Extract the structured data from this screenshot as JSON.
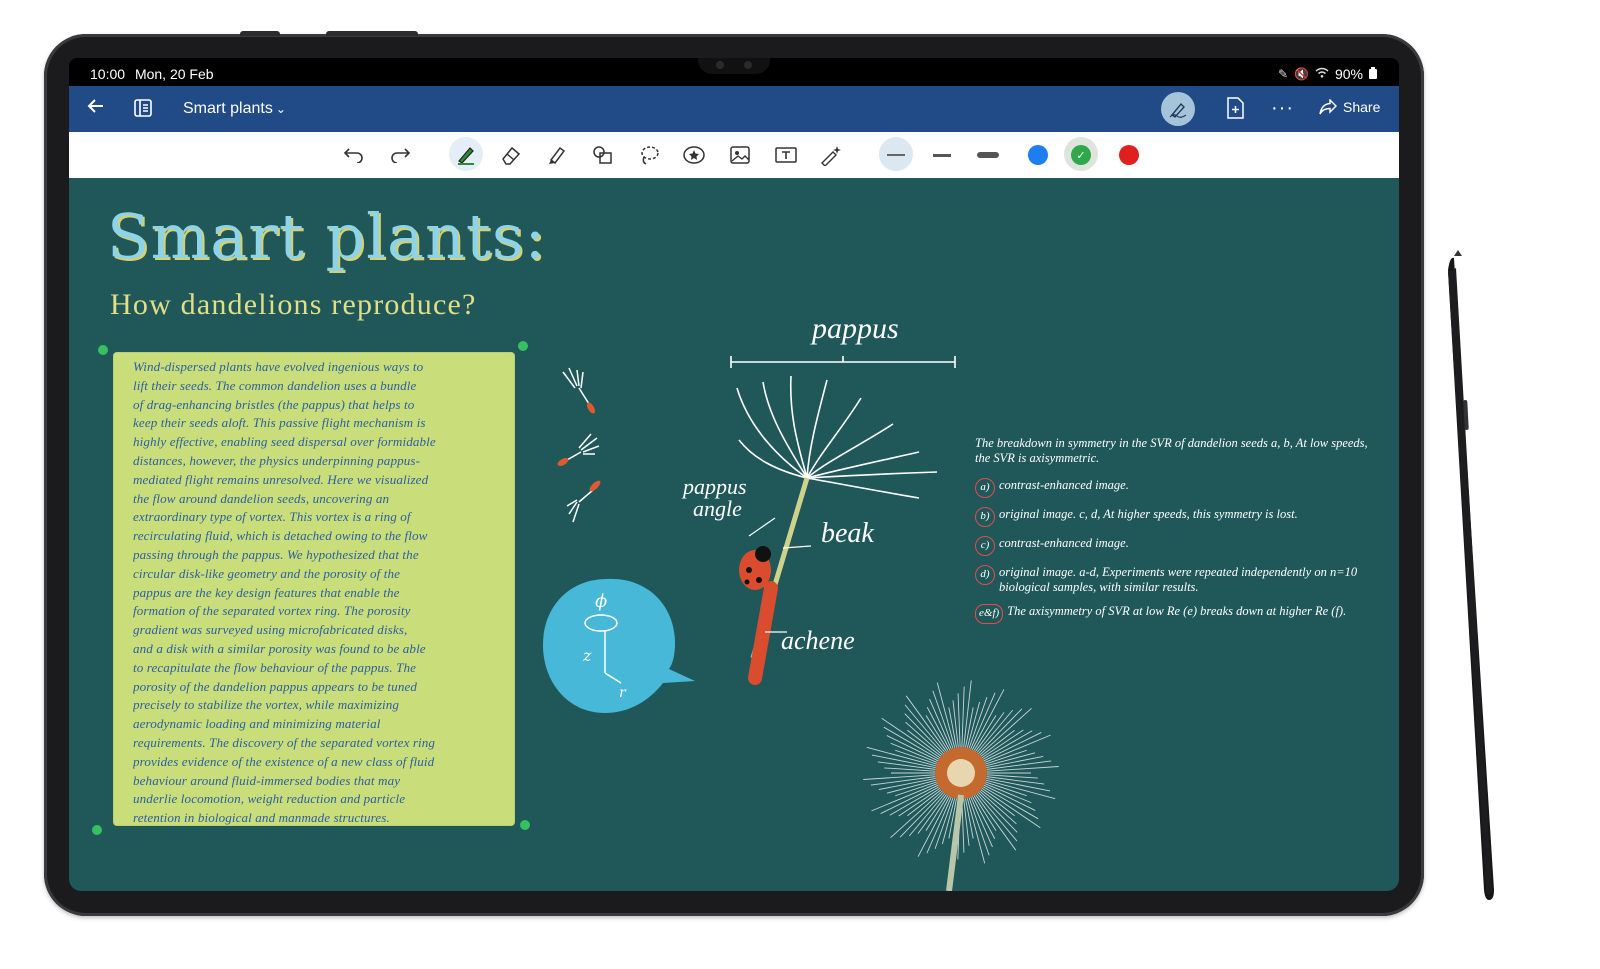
{
  "status_bar": {
    "time": "10:00",
    "date": "Mon, 20 Feb",
    "battery": "90%"
  },
  "app_bar": {
    "title": "Smart plants",
    "share_label": "Share"
  },
  "toolbar": {
    "tools": [
      "undo-icon",
      "redo-icon",
      "pen-icon",
      "eraser-icon",
      "highlighter-icon",
      "shapes-icon",
      "lasso-icon",
      "sticker-icon",
      "image-icon",
      "text-box-icon",
      "magic-icon"
    ],
    "active_tool": "pen-icon",
    "thickness_options": [
      "thin",
      "medium",
      "thick"
    ],
    "selected_thickness": "thin",
    "colors": [
      "#1e7ef0",
      "#2ea84a",
      "#e01f1f"
    ],
    "selected_color": "#2ea84a"
  },
  "canvas": {
    "title": "Smart plants:",
    "subtitle": "How dandelions reproduce?",
    "note_lines": [
      "Wind-dispersed plants have evolved ingenious ways to",
      "lift their seeds. The common dandelion uses a bundle",
      "of drag-enhancing bristles (the pappus) that helps to",
      "keep their seeds aloft. This passive flight mechanism is",
      "highly effective, enabling seed dispersal over formidable",
      "distances, however, the physics underpinning pappus-",
      "mediated flight remains unresolved. Here we visualized",
      "the flow around dandelion seeds, uncovering an",
      "extraordinary type of vortex. This vortex is a ring of",
      "recirculating fluid, which is detached owing to the flow",
      "passing through the pappus. We hypothesized that the",
      "circular disk-like geometry and the porosity of the",
      "pappus are the key design features that enable the",
      "formation of the separated vortex ring. The porosity",
      "gradient was surveyed using microfabricated disks,",
      "and a disk with a similar porosity was found to be able",
      "to recapitulate the flow behaviour of the pappus. The",
      "porosity of the dandelion pappus appears to be tuned",
      "precisely to stabilize the vortex, while maximizing",
      "aerodynamic loading and minimizing material",
      "requirements. The discovery of the separated vortex ring",
      "provides evidence of the existence of a new class of fluid",
      "behaviour around fluid-immersed bodies that may",
      "underlie locomotion, weight reduction and particle",
      "retention in biological and manmade structures."
    ],
    "diagram_labels": {
      "pappus": "pappus",
      "pappus_angle_1": "pappus",
      "pappus_angle_2": "angle",
      "beak": "beak",
      "achene": "achene",
      "phi": "ϕ",
      "z": "z",
      "r": "r"
    },
    "notes_intro": "The breakdown in symmetry in the SVR of dandelion seeds a, b, At low speeds, the SVR is axisymmetric.",
    "notes": [
      {
        "tag": "a)",
        "text": "contrast-enhanced image."
      },
      {
        "tag": "b)",
        "text": "original image. c, d, At higher speeds, this symmetry is lost."
      },
      {
        "tag": "c)",
        "text": "contrast-enhanced image."
      },
      {
        "tag": "d)",
        "text": "original image. a-d, Experiments were repeated independently on n=10 biological samples, with similar results."
      },
      {
        "tag": "e&f)",
        "text": "The axisymmetry of SVR at low Re (e) breaks down at higher Re (f)."
      }
    ]
  }
}
